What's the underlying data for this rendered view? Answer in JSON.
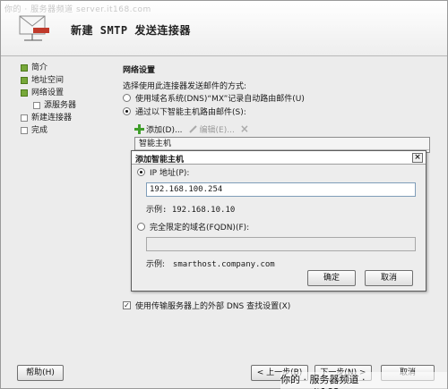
{
  "watermark": {
    "top": "你的 · 服务器频道 server.it168.com",
    "bottom": "你的 · 服务器频道 · server.it168.com"
  },
  "header": {
    "title": "新建 SMTP 发送连接器"
  },
  "steps": [
    {
      "label": "简介"
    },
    {
      "label": "地址空间"
    },
    {
      "label": "网络设置"
    },
    {
      "label": "源服务器"
    },
    {
      "label": "新建连接器"
    },
    {
      "label": "完成"
    }
  ],
  "main": {
    "section_title": "网络设置",
    "prompt": "选择使用此连接器发送邮件的方式:",
    "option_dns": "使用域名系统(DNS)“MX”记录自动路由邮件(U)",
    "option_smarthost": "通过以下智能主机路由邮件(S):",
    "toolbar": {
      "add": "添加(D)...",
      "edit": "编辑(E)...",
      "remove_icon": "×"
    },
    "list_header": "智能主机",
    "external_dns": "使用传输服务器上的外部 DNS 查找设置(X)"
  },
  "dialog": {
    "title": "添加智能主机",
    "close": "×",
    "ip_label": "IP 地址(P):",
    "ip_value": "192.168.100.254",
    "ip_example": "示例: 192.168.10.10",
    "fqdn_label": "完全限定的域名(FQDN)(F):",
    "fqdn_value": "",
    "fqdn_example_prefix": "示例:",
    "fqdn_example": "smarthost.company.com",
    "ok": "确定",
    "cancel": "取消"
  },
  "footer": {
    "help": "帮助(H)",
    "back": "< 上一步(B)",
    "next": "下一步(N) >",
    "cancel": "取消"
  }
}
